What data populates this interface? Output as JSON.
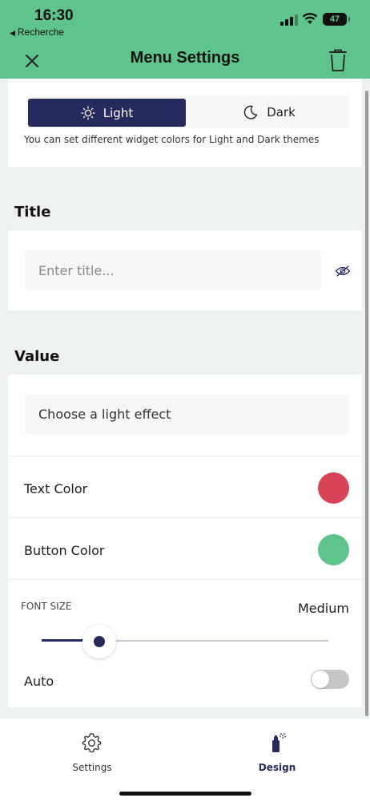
{
  "status_bar": {
    "time": "16:30",
    "back_label": "Recherche",
    "battery": "47"
  },
  "nav": {
    "title": "Menu Settings"
  },
  "theme": {
    "options": [
      "Light",
      "Dark"
    ],
    "selected": "Light",
    "hint": "You can set different widget colors for Light and Dark themes"
  },
  "title_section": {
    "heading": "Title",
    "placeholder": "Enter title...",
    "value": ""
  },
  "value_section": {
    "heading": "Value",
    "effect_placeholder": "Choose a light effect",
    "text_color_label": "Text Color",
    "text_color": "#d94358",
    "button_color_label": "Button Color",
    "button_color": "#5fc48c",
    "font_size_label": "FONT SIZE",
    "font_size_value": "Medium",
    "font_size_level": 0.2,
    "auto_label": "Auto",
    "auto_enabled": false
  },
  "tabs": [
    {
      "label": "Settings",
      "icon": "gear-icon",
      "active": false
    },
    {
      "label": "Design",
      "icon": "spray-can-icon",
      "active": true
    }
  ],
  "colors": {
    "accent": "#5fc48c",
    "primary": "#262a5c",
    "background": "#eef1f2"
  }
}
